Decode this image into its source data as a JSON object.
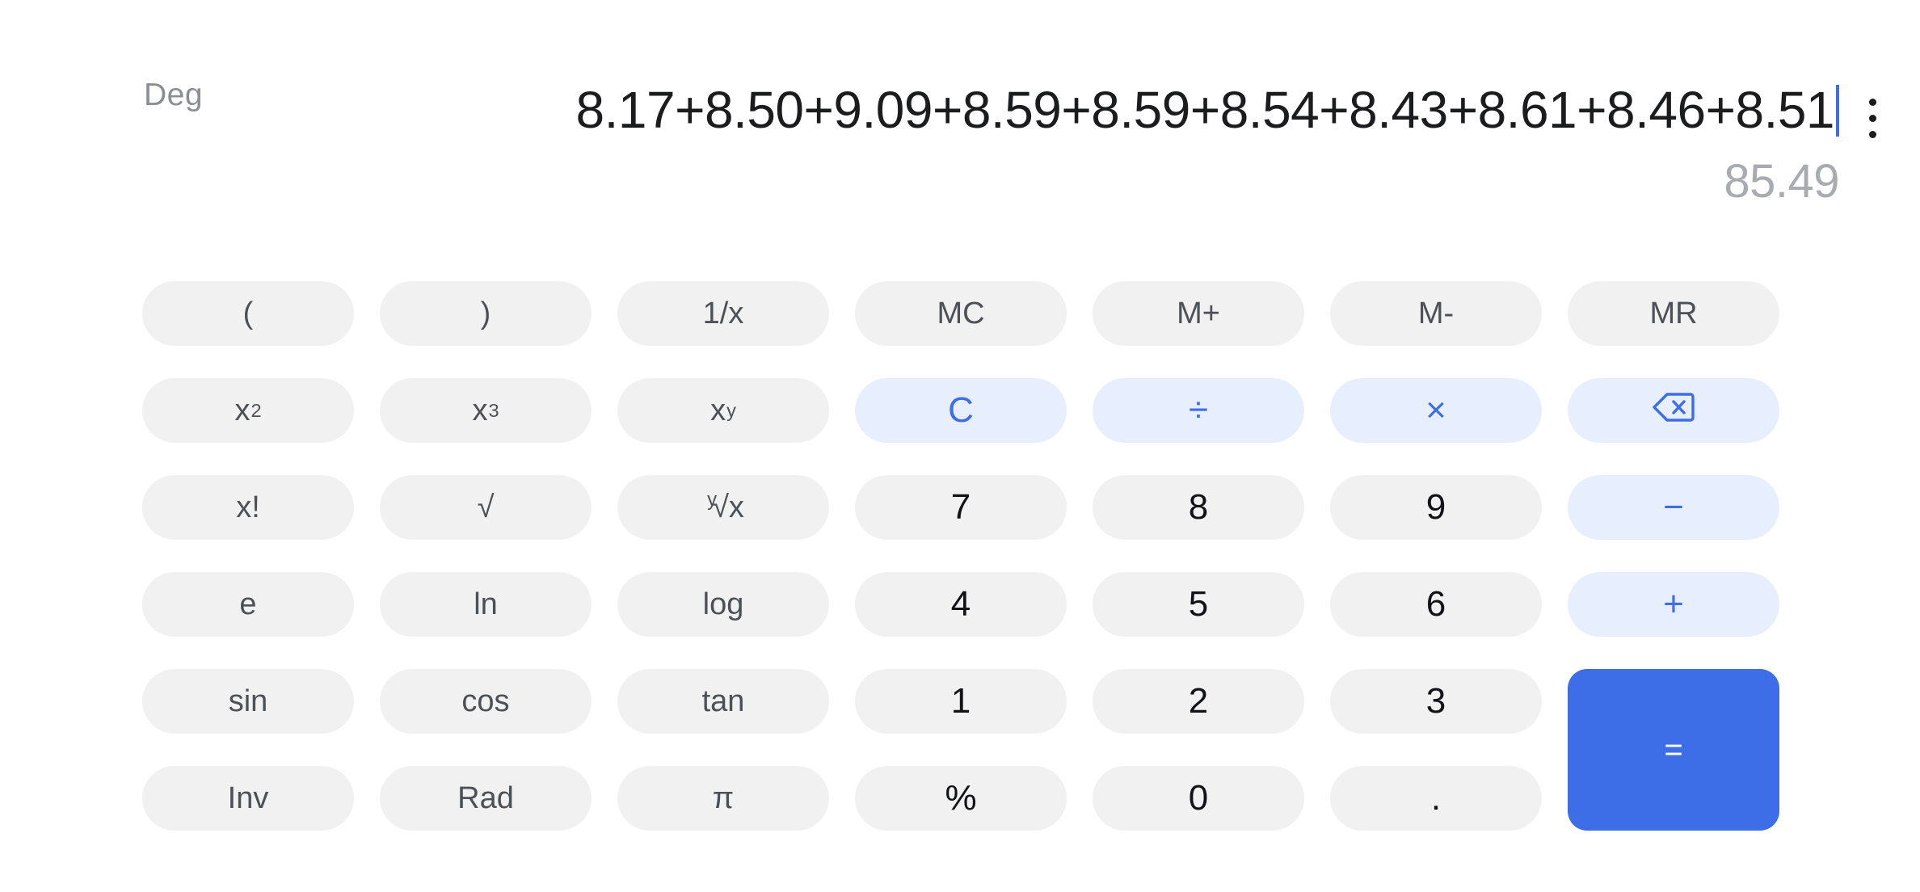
{
  "app": {
    "title": "Calculator",
    "accent_color": "#3d6ee8",
    "operator_bg_color": "#e7eefd",
    "key_bg_color": "#f1f1f1",
    "background_color": "#ffffff"
  },
  "display": {
    "angle_mode": "Deg",
    "expression": "8.17+8.50+9.09+8.59+8.59+8.54+8.43+8.61+8.46+8.51",
    "result": "85.49",
    "caret_visible": true,
    "menu_icon": "overflow-menu-icon"
  },
  "keypad": {
    "rows": [
      [
        {
          "label": "(",
          "name": "open-paren-key",
          "type": "fn"
        },
        {
          "label": ")",
          "name": "close-paren-key",
          "type": "fn"
        },
        {
          "label": "1/x",
          "name": "reciprocal-key",
          "type": "fn"
        },
        {
          "label": "MC",
          "name": "memory-clear-key",
          "type": "fn"
        },
        {
          "label": "M+",
          "name": "memory-add-key",
          "type": "fn"
        },
        {
          "label": "M-",
          "name": "memory-subtract-key",
          "type": "fn"
        },
        {
          "label": "MR",
          "name": "memory-recall-key",
          "type": "fn"
        }
      ],
      [
        {
          "label": "x2",
          "name": "square-key",
          "type": "fn"
        },
        {
          "label": "x3",
          "name": "cube-key",
          "type": "fn"
        },
        {
          "label": "xy",
          "name": "power-key",
          "type": "fn"
        },
        {
          "label": "C",
          "name": "clear-key",
          "type": "op"
        },
        {
          "label": "÷",
          "name": "divide-key",
          "type": "op"
        },
        {
          "label": "×",
          "name": "multiply-key",
          "type": "op"
        },
        {
          "label": "",
          "name": "backspace-key",
          "type": "op",
          "icon": "backspace-icon"
        }
      ],
      [
        {
          "label": "x!",
          "name": "factorial-key",
          "type": "fn"
        },
        {
          "label": "√",
          "name": "square-root-key",
          "type": "fn"
        },
        {
          "label": "y√x",
          "name": "nth-root-key",
          "type": "fn"
        },
        {
          "label": "7",
          "name": "digit-7-key",
          "type": "digit"
        },
        {
          "label": "8",
          "name": "digit-8-key",
          "type": "digit"
        },
        {
          "label": "9",
          "name": "digit-9-key",
          "type": "digit"
        },
        {
          "label": "−",
          "name": "subtract-key",
          "type": "op"
        }
      ],
      [
        {
          "label": "e",
          "name": "euler-key",
          "type": "fn"
        },
        {
          "label": "ln",
          "name": "natural-log-key",
          "type": "fn"
        },
        {
          "label": "log",
          "name": "log-key",
          "type": "fn"
        },
        {
          "label": "4",
          "name": "digit-4-key",
          "type": "digit"
        },
        {
          "label": "5",
          "name": "digit-5-key",
          "type": "digit"
        },
        {
          "label": "6",
          "name": "digit-6-key",
          "type": "digit"
        },
        {
          "label": "+",
          "name": "add-key",
          "type": "op"
        }
      ],
      [
        {
          "label": "sin",
          "name": "sine-key",
          "type": "fn"
        },
        {
          "label": "cos",
          "name": "cosine-key",
          "type": "fn"
        },
        {
          "label": "tan",
          "name": "tangent-key",
          "type": "fn"
        },
        {
          "label": "1",
          "name": "digit-1-key",
          "type": "digit"
        },
        {
          "label": "2",
          "name": "digit-2-key",
          "type": "digit"
        },
        {
          "label": "3",
          "name": "digit-3-key",
          "type": "digit"
        },
        {
          "label": "=",
          "name": "equals-key",
          "type": "equals"
        }
      ],
      [
        {
          "label": "Inv",
          "name": "inverse-key",
          "type": "fn"
        },
        {
          "label": "Rad",
          "name": "radian-mode-key",
          "type": "fn"
        },
        {
          "label": "π",
          "name": "pi-key",
          "type": "fn"
        },
        {
          "label": "%",
          "name": "percent-key",
          "type": "digit"
        },
        {
          "label": "0",
          "name": "digit-0-key",
          "type": "digit"
        },
        {
          "label": ".",
          "name": "decimal-point-key",
          "type": "digit"
        }
      ]
    ]
  }
}
